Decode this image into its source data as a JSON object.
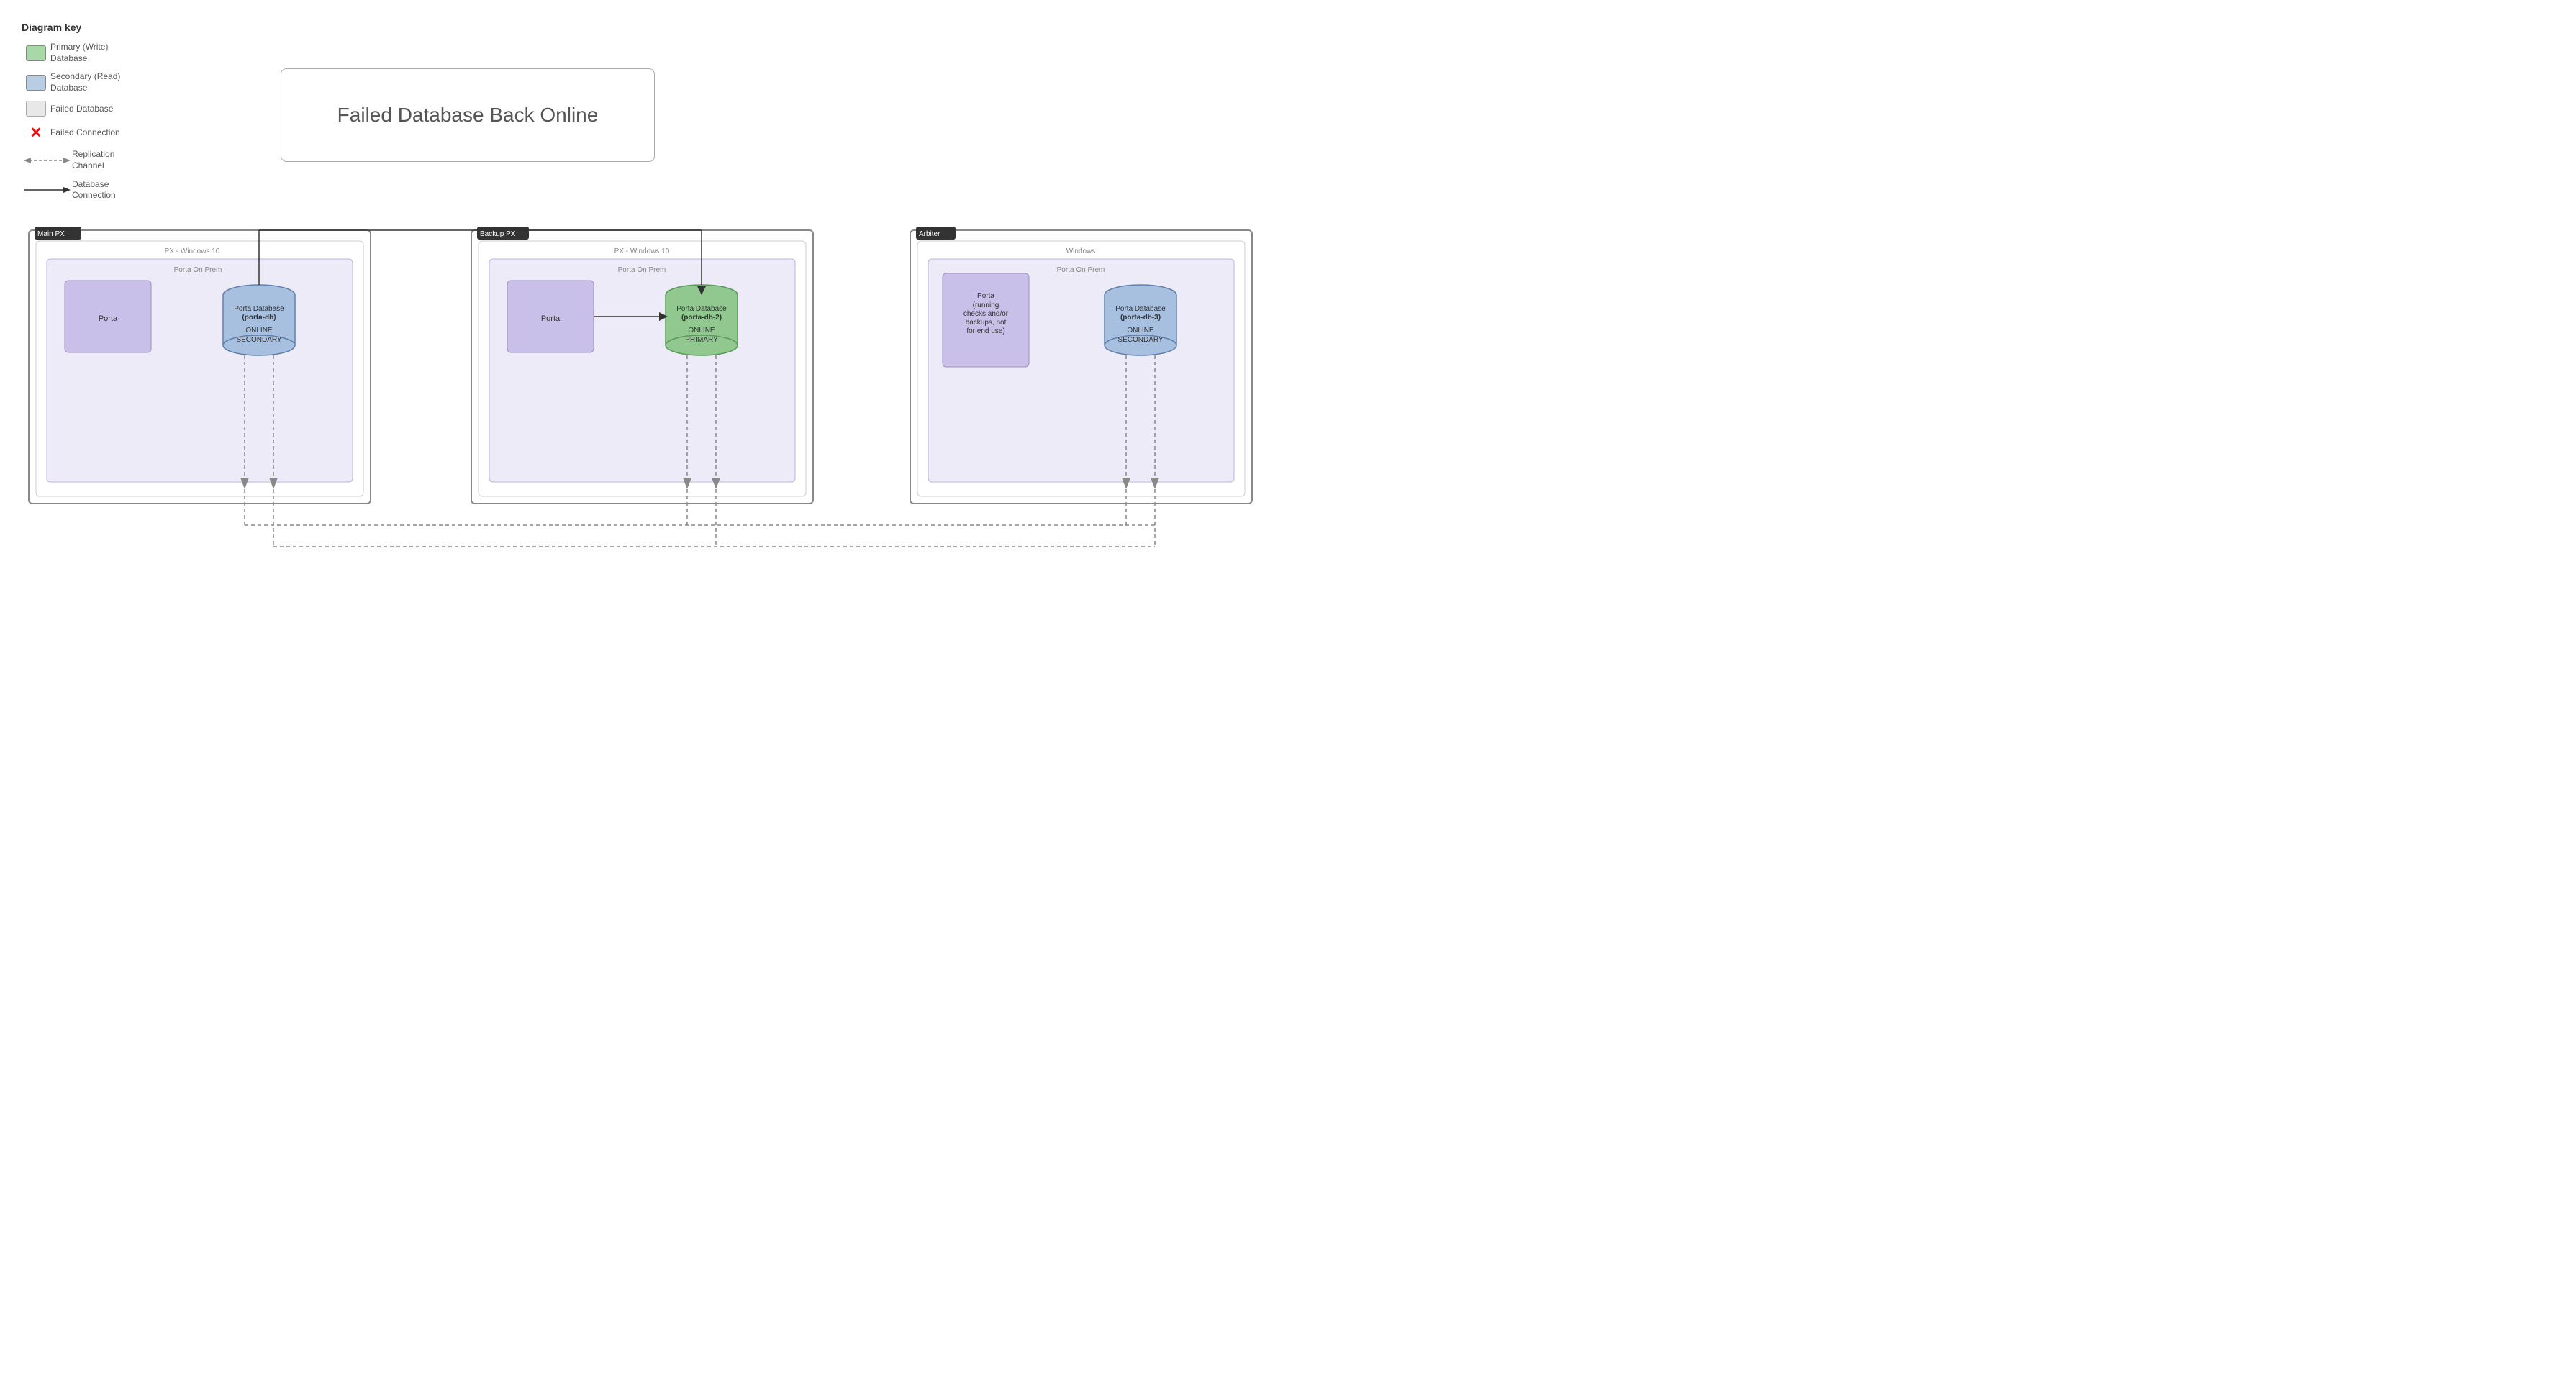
{
  "diagram_key": {
    "title": "Diagram key",
    "items": [
      {
        "label": "Primary (Write)\nDatabase",
        "type": "green-box"
      },
      {
        "label": "Secondary (Read)\nDatabase",
        "type": "blue-box"
      },
      {
        "label": "Failed Database",
        "type": "gray-box"
      },
      {
        "label": "Failed Connection",
        "type": "x-mark"
      },
      {
        "label": "Replication\nChannel",
        "type": "dashed-arrow"
      },
      {
        "label": "Database\nConnection",
        "type": "solid-arrow"
      }
    ]
  },
  "title_box": {
    "text": "Failed Database Back Online"
  },
  "clusters": [
    {
      "id": "main-px",
      "label": "Main PX",
      "os": "PX - Windows 10",
      "prem_label": "Porta On Prem",
      "porta_label": "Porta",
      "db_label": "Porta Database\n(porta-db)",
      "db_status": "ONLINE",
      "db_role": "SECONDARY",
      "db_color": "blue"
    },
    {
      "id": "backup-px",
      "label": "Backup PX",
      "os": "PX - Windows 10",
      "prem_label": "Porta On Prem",
      "porta_label": "Porta",
      "db_label": "Porta Database\n(porta-db-2)",
      "db_status": "ONLINE",
      "db_role": "PRIMARY",
      "db_color": "green"
    },
    {
      "id": "arbiter",
      "label": "Arbiter",
      "os": "Windows",
      "prem_label": "Porta On Prem",
      "porta_label": "Porta\n(running\nchecks and/or\nbackups, not\nfor end use)",
      "db_label": "Porta Database\n(porta-db-3)",
      "db_status": "ONLINE",
      "db_role": "SECONDARY",
      "db_color": "blue"
    }
  ]
}
